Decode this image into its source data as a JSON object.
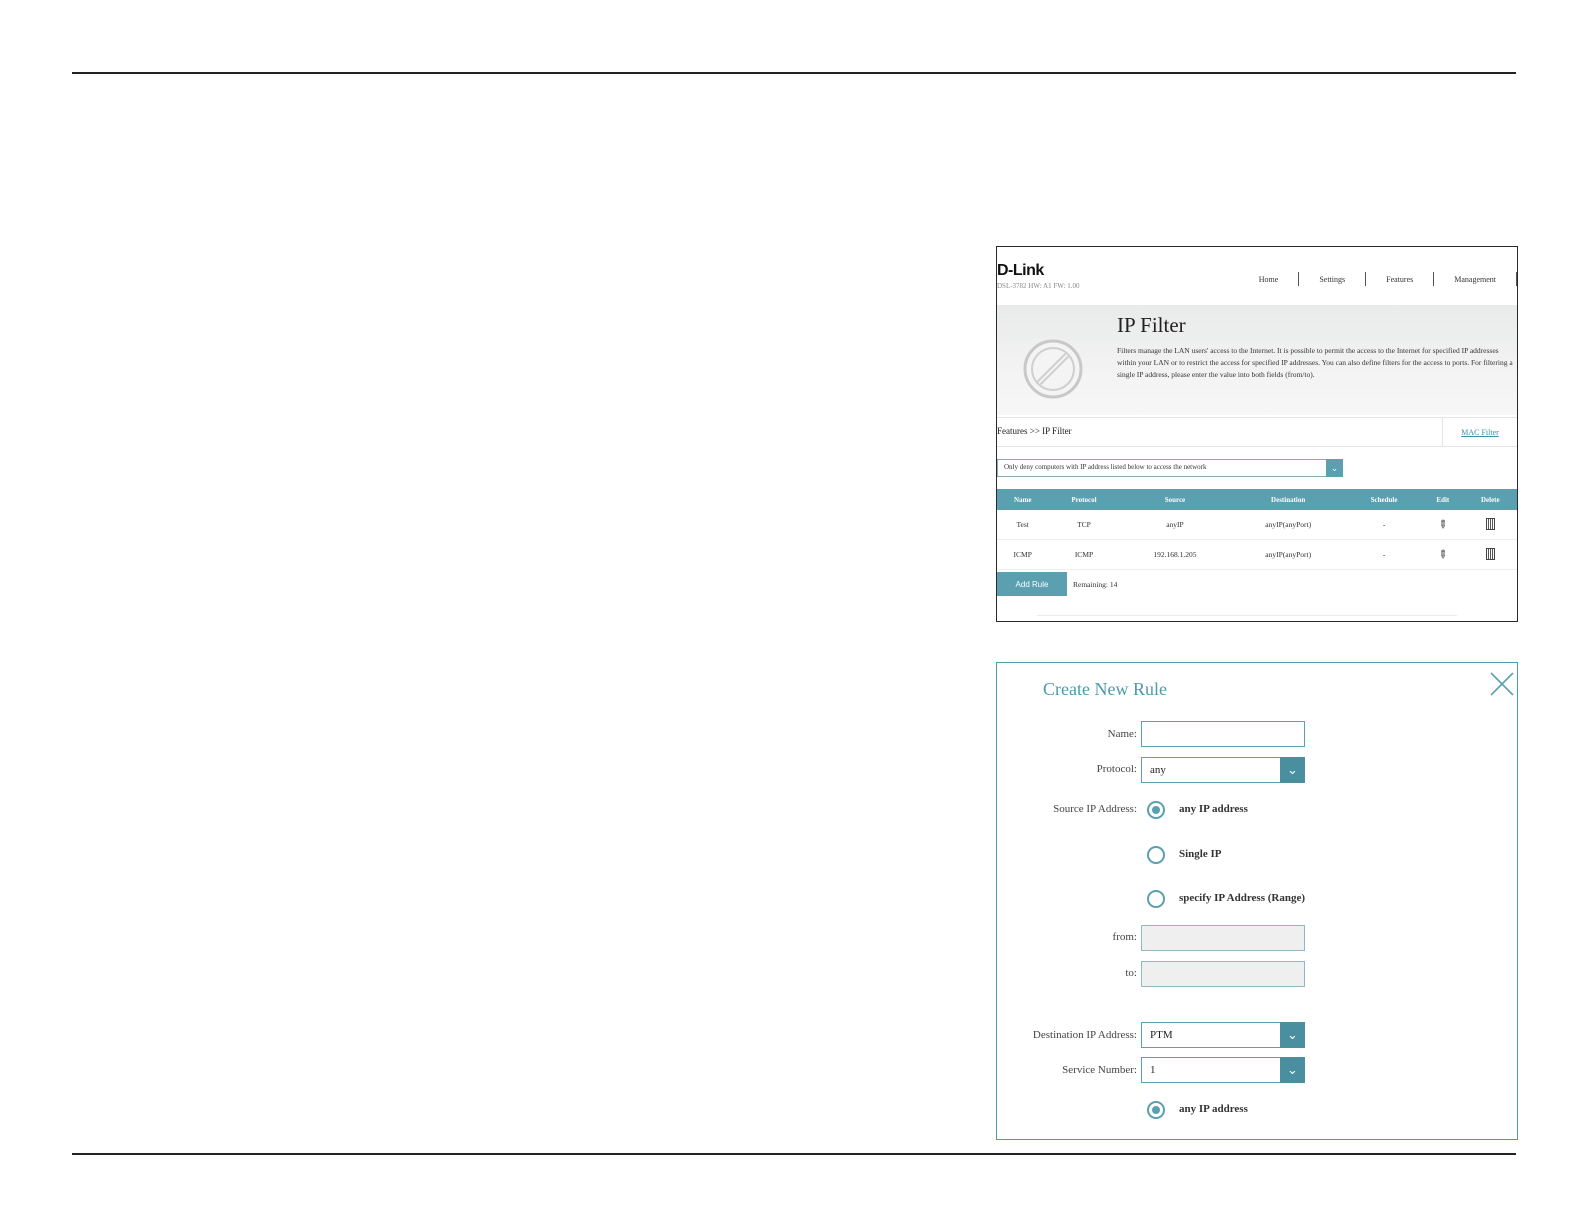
{
  "router": {
    "logo": "D-Link",
    "model": "DSL-3782  HW: A1  FW: 1.00",
    "nav": [
      "Home",
      "Settings",
      "Features",
      "Management"
    ],
    "page_title": "IP Filter",
    "description": "Filters manage the LAN users' access to the Internet. It is possible to permit the access to the Internet for specified IP addresses within your LAN or to restrict the access for specified IP addresses. You can also define filters for the access to ports. For filtering a single IP address, please enter the value into both fields (from/to).",
    "breadcrumb": "Features >> IP Filter",
    "mac_filter_link": "MAC Filter",
    "filter_mode": "Only deny computers with IP address listed below to access the network",
    "table": {
      "headers": [
        "Name",
        "Protocol",
        "Source",
        "Destination",
        "Schedule",
        "Edit",
        "Delete"
      ],
      "rows": [
        {
          "name": "Test",
          "protocol": "TCP",
          "source": "anyIP",
          "destination": "anyIP(anyPort)",
          "schedule": "-"
        },
        {
          "name": "ICMP",
          "protocol": "ICMP",
          "source": "192.168.1.205",
          "destination": "anyIP(anyPort)",
          "schedule": "-"
        }
      ]
    },
    "add_rule_label": "Add Rule",
    "remaining": "Remaining: 14"
  },
  "dialog": {
    "title": "Create New Rule",
    "name_label": "Name:",
    "name_value": "",
    "protocol_label": "Protocol:",
    "protocol_value": "any",
    "source_label": "Source IP Address:",
    "source_options": [
      "any IP address",
      "Single IP",
      "specify IP Address (Range)"
    ],
    "source_selected": "any IP address",
    "from_label": "from:",
    "to_label": "to:",
    "destination_label": "Destination IP Address:",
    "destination_value": "PTM",
    "service_label": "Service Number:",
    "service_value": "1",
    "dest_option": "any IP address"
  },
  "colors": {
    "accent": "#5aa0b0",
    "title_teal": "#4a9bac"
  }
}
